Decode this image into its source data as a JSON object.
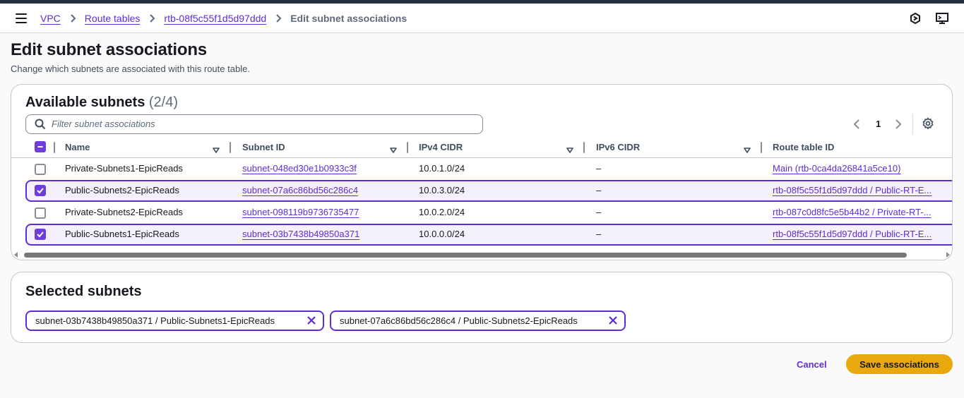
{
  "breadcrumb": {
    "items": [
      "VPC",
      "Route tables",
      "rtb-08f5c55f1d5d97ddd"
    ],
    "current": "Edit subnet associations"
  },
  "page": {
    "title": "Edit subnet associations",
    "description": "Change which subnets are associated with this route table."
  },
  "available": {
    "title": "Available subnets",
    "count": "(2/4)",
    "filter_placeholder": "Filter subnet associations",
    "page_number": "1",
    "columns": [
      "Name",
      "Subnet ID",
      "IPv4 CIDR",
      "IPv6 CIDR",
      "Route table ID"
    ],
    "rows": [
      {
        "selected": false,
        "name": "Private-Subnets1-EpicReads",
        "subnet_id": "subnet-048ed30e1b0933c3f",
        "ipv4": "10.0.1.0/24",
        "ipv6": "–",
        "route_table": "Main (rtb-0ca4da26841a5ce10)"
      },
      {
        "selected": true,
        "name": "Public-Subnets2-EpicReads",
        "subnet_id": "subnet-07a6c86bd56c286c4",
        "ipv4": "10.0.3.0/24",
        "ipv6": "–",
        "route_table": "rtb-08f5c55f1d5d97ddd / Public-RT-E..."
      },
      {
        "selected": false,
        "name": "Private-Subnets2-EpicReads",
        "subnet_id": "subnet-098119b9736735477",
        "ipv4": "10.0.2.0/24",
        "ipv6": "–",
        "route_table": "rtb-087c0d8fc5e5b44b2 / Private-RT-..."
      },
      {
        "selected": true,
        "name": "Public-Subnets1-EpicReads",
        "subnet_id": "subnet-03b7438b49850a371",
        "ipv4": "10.0.0.0/24",
        "ipv6": "–",
        "route_table": "rtb-08f5c55f1d5d97ddd / Public-RT-E..."
      }
    ]
  },
  "selected": {
    "title": "Selected subnets",
    "tokens": [
      "subnet-03b7438b49850a371 / Public-Subnets1-EpicReads",
      "subnet-07a6c86bd56c286c4 / Public-Subnets2-EpicReads"
    ]
  },
  "actions": {
    "cancel": "Cancel",
    "save": "Save associations"
  },
  "colors": {
    "accent": "#5f2dd3",
    "primary_button": "#e8a80e",
    "selected_row_bg": "#f4f1fc"
  },
  "icons": [
    "menu-icon",
    "chevron-right-icon",
    "notifications-icon",
    "cloudshell-icon",
    "search-icon",
    "sort-caret-icon",
    "chevron-left-icon",
    "gear-icon",
    "close-icon",
    "check-icon"
  ]
}
